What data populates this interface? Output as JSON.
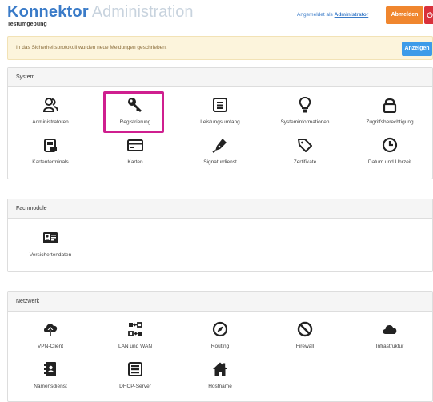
{
  "header": {
    "brand_strong": "Konnektor",
    "brand_light": "Administration",
    "subtitle": "Testumgebung",
    "login_prefix": "Angemeldet als",
    "login_user": "Administrator",
    "logout_label": "Abmelden",
    "power_glyph": "⏻"
  },
  "alert": {
    "text": "In das Sicherheitsprotokoll wurden neue Meldungen geschrieben.",
    "button_label": "Anzeigen"
  },
  "system": {
    "title": "System",
    "items": [
      {
        "label": "Administratoren",
        "icon": "users-icon"
      },
      {
        "label": "Registrierung",
        "icon": "key-icon"
      },
      {
        "label": "Leistungsumfang",
        "icon": "list-box-icon"
      },
      {
        "label": "Systeminformationen",
        "icon": "lightbulb-icon"
      },
      {
        "label": "Zugriffsberechtigung",
        "icon": "lock-icon"
      },
      {
        "label": "Kartenterminals",
        "icon": "card-terminal-icon"
      },
      {
        "label": "Karten",
        "icon": "card-icon"
      },
      {
        "label": "Signaturdienst",
        "icon": "pen-nib-icon"
      },
      {
        "label": "Zertifikate",
        "icon": "tag-icon"
      },
      {
        "label": "Datum und Uhrzeit",
        "icon": "clock-icon"
      }
    ]
  },
  "fachmodule": {
    "title": "Fachmodule",
    "items": [
      {
        "label": "Versichertendaten",
        "icon": "id-card-icon"
      }
    ]
  },
  "netzwerk": {
    "title": "Netzwerk",
    "items": [
      {
        "label": "VPN-Client",
        "icon": "cloud-upload-icon"
      },
      {
        "label": "LAN und WAN",
        "icon": "network-arrows-icon"
      },
      {
        "label": "Routing",
        "icon": "compass-icon"
      },
      {
        "label": "Firewall",
        "icon": "ban-icon"
      },
      {
        "label": "Infrastruktur",
        "icon": "cloud-icon"
      },
      {
        "label": "Namensdienst",
        "icon": "address-book-icon"
      },
      {
        "label": "DHCP-Server",
        "icon": "server-box-icon"
      },
      {
        "label": "Hostname",
        "icon": "home-icon"
      }
    ]
  },
  "colors": {
    "brand": "#3a7bc8",
    "logout": "#f0862e",
    "power": "#d9313b",
    "alert_bg": "#fcf4dc",
    "alert_button": "#3d9be9",
    "highlight": "#cf1f8f",
    "icon": "#222222"
  }
}
